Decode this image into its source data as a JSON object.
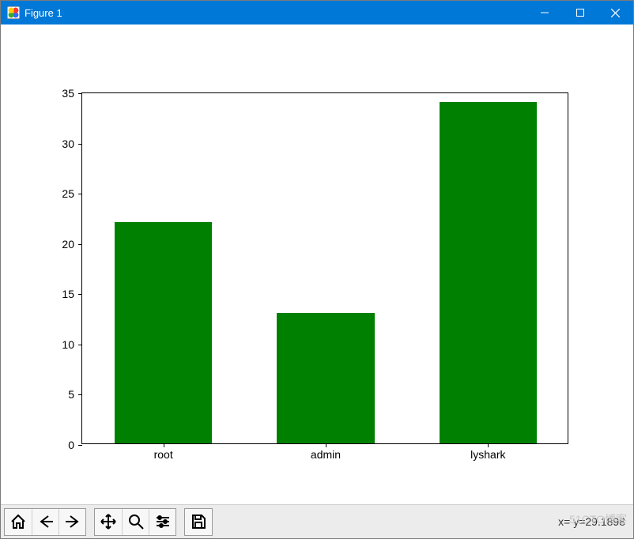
{
  "window": {
    "title": "Figure 1"
  },
  "chart_data": {
    "type": "bar",
    "categories": [
      "root",
      "admin",
      "lyshark"
    ],
    "values": [
      22,
      13,
      34
    ],
    "title": "",
    "xlabel": "",
    "ylabel": "",
    "ylim": [
      0,
      35
    ],
    "yticks": [
      0,
      5,
      10,
      15,
      20,
      25,
      30,
      35
    ],
    "bar_color": "#008000"
  },
  "toolbar": {
    "coords_text": "x=  y=29.1898"
  },
  "watermark": "51CTO博客"
}
